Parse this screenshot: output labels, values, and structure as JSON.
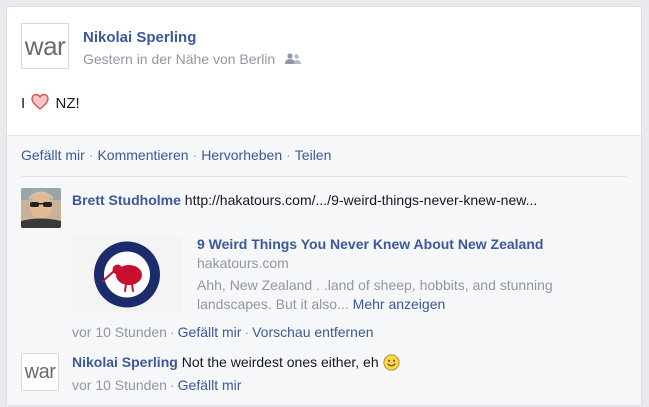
{
  "post": {
    "author_logo": "war",
    "author_name": "Nikolai Sperling",
    "subtitle": "Gestern in der Nähe von Berlin",
    "privacy_icon": "friends-icon",
    "text_before": "I",
    "text_icon": "heart-icon",
    "text_after": "NZ!"
  },
  "actions": {
    "like": "Gefällt mir",
    "comment": "Kommentieren",
    "highlight": "Hervorheben",
    "share": "Teilen",
    "separator": "·"
  },
  "comments": [
    {
      "author": "Brett Studholme",
      "text": "http://hakatours.com/.../9-weird-things-never-knew-new...",
      "preview": {
        "image_icon": "kiwi-roundel-icon",
        "title": "9 Weird Things You Never Knew About New Zealand",
        "domain": "hakatours.com",
        "description": "Ahh, New Zealand . .land of sheep, hobbits, and stunning landscapes. But it also...",
        "more": "Mehr anzeigen"
      },
      "time": "vor 10 Stunden",
      "like": "Gefällt mir",
      "remove_preview": "Vorschau entfernen"
    },
    {
      "author_logo": "war",
      "author": "Nikolai Sperling",
      "text": "Not the weirdest ones either, eh",
      "emoticon": "smiley-icon",
      "time": "vor 10 Stunden",
      "like": "Gefällt mir"
    }
  ],
  "colors": {
    "link": "#3b5998",
    "muted": "#9197a3",
    "heart": "#e0245e",
    "roundel_blue": "#1c2b6b",
    "roundel_red": "#c8102e"
  }
}
